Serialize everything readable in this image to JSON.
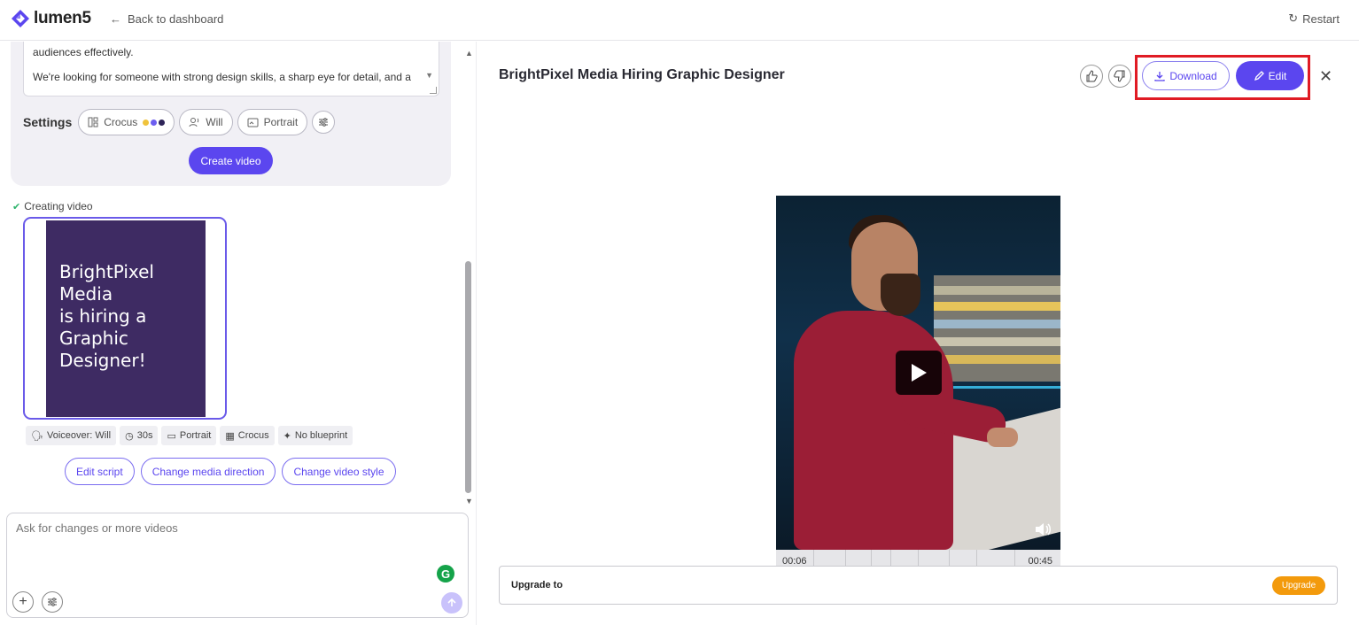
{
  "app": {
    "name": "lumen5",
    "brand_color": "#5b46ef"
  },
  "topbar": {
    "back_label": "Back to dashboard",
    "restart_label": "Restart"
  },
  "prompt": {
    "line1": "audiences effectively.",
    "line2": "We're looking for someone with strong design skills, a sharp eye for detail, and a"
  },
  "settings": {
    "label": "Settings",
    "theme": "Crocus",
    "theme_colors": [
      "#f0c33c",
      "#6d5ef0",
      "#2d2458"
    ],
    "voice": "Will",
    "orientation": "Portrait"
  },
  "create_button": "Create video",
  "status": {
    "creating_label": "Creating video"
  },
  "thumbnail": {
    "lines": [
      "BrightPixel",
      "Media",
      "is hiring a",
      "Graphic",
      "Designer!"
    ]
  },
  "tags": [
    {
      "icon": "voiceover-icon",
      "label": "Voiceover: Will"
    },
    {
      "icon": "clock-icon",
      "label": "30s"
    },
    {
      "icon": "portrait-icon",
      "label": "Portrait"
    },
    {
      "icon": "layout-icon",
      "label": "Crocus"
    },
    {
      "icon": "sparkle-icon",
      "label": "No blueprint"
    }
  ],
  "actions": [
    "Edit script",
    "Change media direction",
    "Change video style"
  ],
  "chat": {
    "placeholder": "Ask for changes or more videos"
  },
  "video": {
    "title": "BrightPixel Media Hiring Graphic Designer",
    "download_label": "Download",
    "edit_label": "Edit",
    "time_current": "00:06",
    "time_total": "00:45"
  },
  "upgrade": {
    "label": "Upgrade to",
    "button": "Upgrade",
    "color": "#f39a0c"
  }
}
